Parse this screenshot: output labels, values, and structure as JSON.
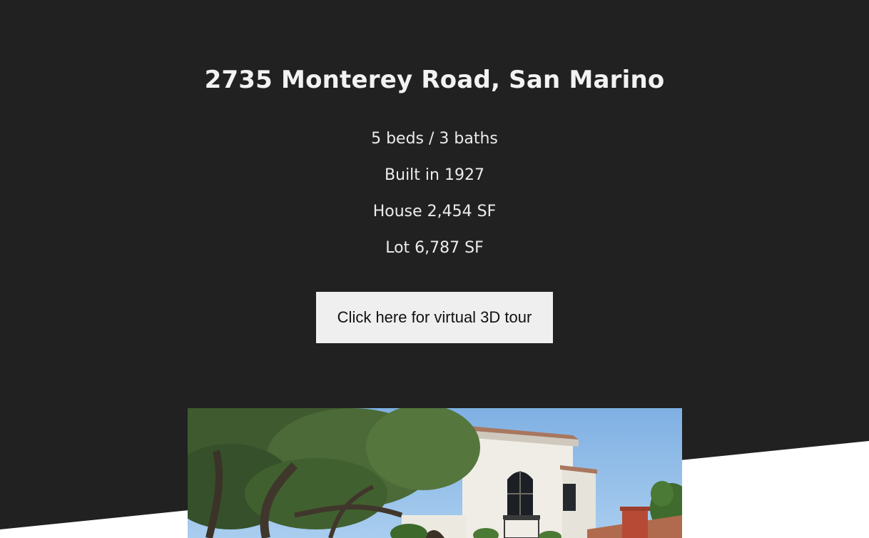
{
  "listing": {
    "address": "2735 Monterey Road, San Marino",
    "specs": [
      "5 beds / 3 baths",
      "Built in 1927",
      "House 2,454 SF",
      "Lot 6,787 SF"
    ],
    "tour_button_label": "Click here for virtual 3D tour"
  },
  "colors": {
    "dark_background": "#212121",
    "light_background": "#ffffff",
    "button_background": "#efefef"
  }
}
